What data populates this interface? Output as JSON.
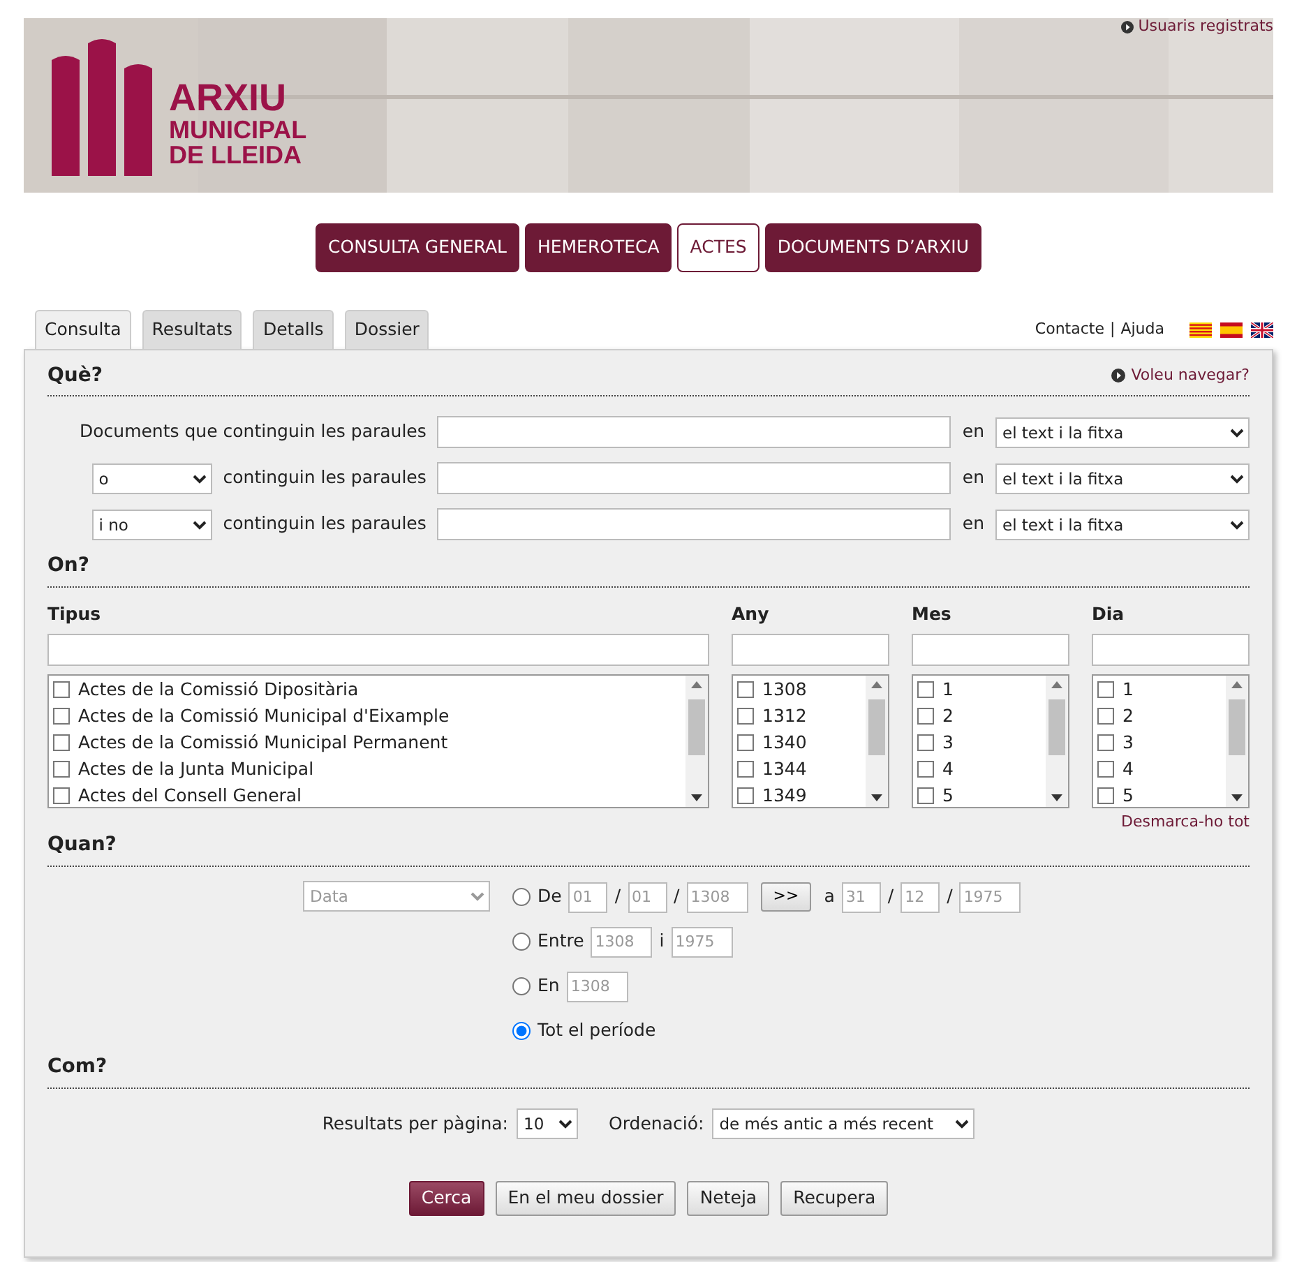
{
  "top_link": {
    "label": "Usuaris registrats"
  },
  "banner": {
    "logo_lines": [
      "ARXIU",
      "MUNICIPAL",
      "DE LLEIDA"
    ]
  },
  "sections_nav": [
    {
      "label": "CONSULTA GENERAL",
      "selected": false
    },
    {
      "label": "HEMEROTECA",
      "selected": false
    },
    {
      "label": "ACTES",
      "selected": true
    },
    {
      "label": "DOCUMENTS D’ARXIU",
      "selected": false
    }
  ],
  "tabs": [
    {
      "label": "Consulta",
      "selected": true
    },
    {
      "label": "Resultats",
      "selected": false
    },
    {
      "label": "Detalls",
      "selected": false
    },
    {
      "label": "Dossier",
      "selected": false
    }
  ],
  "header_links": {
    "items": [
      "Contacte",
      "Ajuda"
    ],
    "separator": "|"
  },
  "languages": [
    {
      "kind": "catalan"
    },
    {
      "kind": "spanish"
    },
    {
      "kind": "english"
    }
  ],
  "what": {
    "title": "Què?",
    "browse_link": "Voleu navegar?",
    "rows": [
      {
        "kind": "label",
        "label": "Documents que continguin les paraules",
        "in_label": "en",
        "scope": "el text i la fitxa"
      },
      {
        "kind": "operator",
        "operator": "o",
        "label": "continguin les paraules",
        "in_label": "en",
        "scope": "el text i la fitxa"
      },
      {
        "kind": "operator",
        "operator": "i no",
        "label": "continguin les paraules",
        "in_label": "en",
        "scope": "el text i la fitxa"
      }
    ]
  },
  "where": {
    "title": "On?",
    "clear_link": "Desmarca-ho tot",
    "lists": [
      {
        "heading": "Tipus",
        "items": [
          {
            "label": "Actes de la Comissió Dipositària",
            "checked": false
          },
          {
            "label": "Actes de la Comissió Municipal d'Eixample",
            "checked": false
          },
          {
            "label": "Actes de la Comissió Municipal Permanent",
            "checked": false
          },
          {
            "label": "Actes de la Junta Municipal",
            "checked": false
          },
          {
            "label": "Actes del Consell General",
            "checked": false
          }
        ]
      },
      {
        "heading": "Any",
        "items": [
          {
            "label": "1308",
            "checked": false
          },
          {
            "label": "1312",
            "checked": false
          },
          {
            "label": "1340",
            "checked": false
          },
          {
            "label": "1344",
            "checked": false
          },
          {
            "label": "1349",
            "checked": false
          }
        ]
      },
      {
        "heading": "Mes",
        "items": [
          {
            "label": "1",
            "checked": false
          },
          {
            "label": "2",
            "checked": false
          },
          {
            "label": "3",
            "checked": false
          },
          {
            "label": "4",
            "checked": false
          },
          {
            "label": "5",
            "checked": false
          }
        ]
      },
      {
        "heading": "Dia",
        "items": [
          {
            "label": "1",
            "checked": false
          },
          {
            "label": "2",
            "checked": false
          },
          {
            "label": "3",
            "checked": false
          },
          {
            "label": "4",
            "checked": false
          },
          {
            "label": "5",
            "checked": false
          }
        ]
      }
    ]
  },
  "when": {
    "title": "Quan?",
    "date_type": {
      "value": "Data",
      "disabled": true
    },
    "options": [
      {
        "kind": "from_to",
        "label": "De",
        "selected": false,
        "from": [
          "01",
          "01",
          "1308"
        ],
        "separator": "/",
        "button": ">>",
        "to_label": "a",
        "to": [
          "31",
          "12",
          "1975"
        ]
      },
      {
        "kind": "between",
        "label": "Entre",
        "selected": false,
        "from": "1308",
        "and_label": "i",
        "to": "1975"
      },
      {
        "kind": "in",
        "label": "En",
        "selected": false,
        "year": "1308"
      },
      {
        "kind": "all",
        "label": "Tot el període",
        "selected": true
      }
    ]
  },
  "how": {
    "title": "Com?",
    "per_page_label": "Resultats per pàgina:",
    "per_page": "10",
    "order_label": "Ordenació:",
    "order": "de més antic a més recent"
  },
  "actions": [
    {
      "label": "Cerca",
      "kind": "primary"
    },
    {
      "label": "En el meu dossier",
      "kind": "secondary"
    },
    {
      "label": "Neteja",
      "kind": "secondary"
    },
    {
      "label": "Recupera",
      "kind": "secondary"
    }
  ]
}
